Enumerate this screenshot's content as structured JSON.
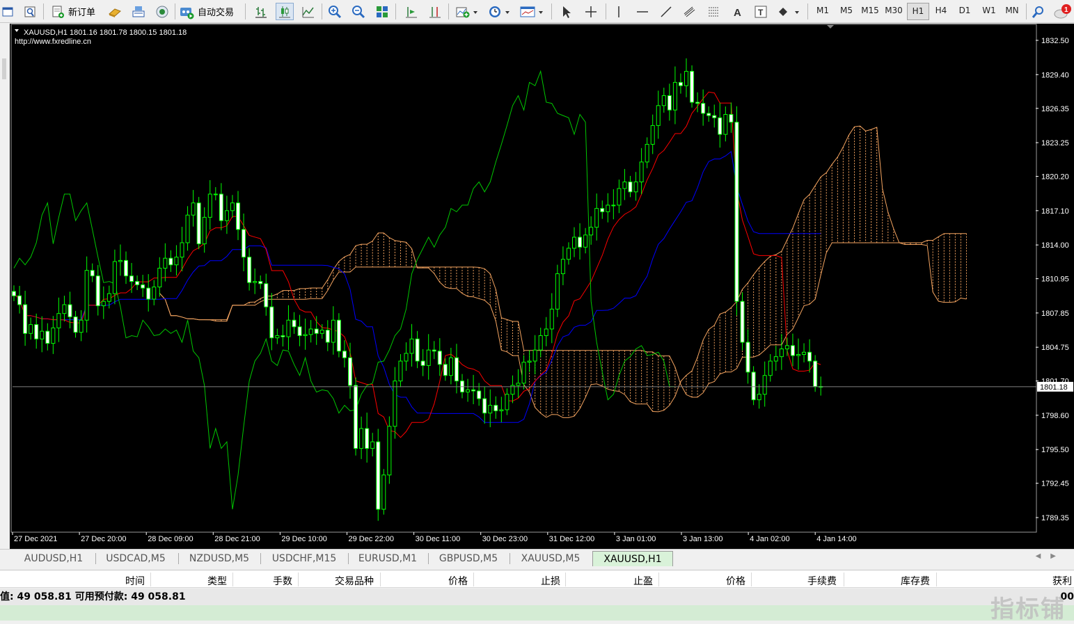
{
  "toolbar": {
    "new_order_label": "新订单",
    "auto_trading_label": "自动交易",
    "timeframes": [
      "M1",
      "M5",
      "M15",
      "M30",
      "H1",
      "H4",
      "D1",
      "W1",
      "MN"
    ],
    "active_timeframe": "H1",
    "notification_count": "1"
  },
  "chart": {
    "header": "XAUUSD,H1  1801.16 1801.78 1800.15 1801.18",
    "url": "http://www.fxredline.cn",
    "current_price_label": "1801.18"
  },
  "chart_data": {
    "type": "candlestick",
    "symbol": "XAUUSD",
    "timeframe": "H1",
    "ohlc_last": {
      "open": 1801.16,
      "high": 1801.78,
      "low": 1800.15,
      "close": 1801.18
    },
    "ylim": [
      1788.0,
      1834.0
    ],
    "y_ticks": [
      1832.5,
      1829.4,
      1826.35,
      1823.25,
      1820.2,
      1817.1,
      1814.0,
      1810.95,
      1807.85,
      1804.75,
      1801.7,
      1798.6,
      1795.5,
      1792.45,
      1789.35
    ],
    "y_tick_labels": [
      "1832.50",
      "1829.40",
      "1826.35",
      "1823.25",
      "1820.20",
      "1817.10",
      "1814.00",
      "1810.95",
      "1807.85",
      "1804.75",
      "1801.70",
      "1798.60",
      "1795.50",
      "1792.45",
      "1789.35"
    ],
    "x_tick_labels": [
      "27 Dec 2021",
      "27 Dec 20:00",
      "28 Dec 09:00",
      "28 Dec 21:00",
      "29 Dec 10:00",
      "29 Dec 22:00",
      "30 Dec 11:00",
      "30 Dec 23:00",
      "31 Dec 12:00",
      "3 Jan 01:00",
      "3 Jan 13:00",
      "4 Jan 02:00",
      "4 Jan 14:00"
    ],
    "bar_count": 145,
    "candles_close": [
      1809.4,
      1808.6,
      1806.0,
      1806.8,
      1805.5,
      1806.2,
      1805.1,
      1806.5,
      1807.8,
      1808.6,
      1807.5,
      1806.1,
      1807.2,
      1811.7,
      1811.2,
      1808.5,
      1808.9,
      1809.6,
      1812.5,
      1812.6,
      1811.2,
      1810.7,
      1810.4,
      1810.1,
      1809.1,
      1810.2,
      1811.9,
      1812.8,
      1812.2,
      1812.9,
      1814.2,
      1816.7,
      1817.8,
      1814.1,
      1816.5,
      1818.6,
      1818.6,
      1816.2,
      1817.1,
      1817.8,
      1815.4,
      1812.9,
      1810.6,
      1810.7,
      1810.5,
      1808.4,
      1805.6,
      1805.8,
      1805.7,
      1807.2,
      1806.6,
      1805.8,
      1805.9,
      1806.4,
      1806.0,
      1806.3,
      1805.2,
      1807.2,
      1804.4,
      1803.8,
      1801.3,
      1795.6,
      1797.4,
      1795.6,
      1796.2,
      1790.1,
      1793.2,
      1797.6,
      1801.7,
      1803.5,
      1804.2,
      1805.5,
      1803.5,
      1803.1,
      1804.5,
      1804.4,
      1803.2,
      1802.2,
      1803.8,
      1801.7,
      1800.7,
      1800.9,
      1800.8,
      1800.1,
      1798.8,
      1799.5,
      1799.0,
      1799.1,
      1800.5,
      1801.3,
      1801.5,
      1803.4,
      1803.5,
      1804.5,
      1805.8,
      1806.4,
      1808.2,
      1811.4,
      1812.7,
      1813.7,
      1814.7,
      1813.8,
      1814.9,
      1815.6,
      1817.3,
      1817.0,
      1817.6,
      1817.6,
      1819.1,
      1819.7,
      1818.8,
      1819.7,
      1821.5,
      1823.1,
      1824.8,
      1826.6,
      1827.5,
      1826.2,
      1828.7,
      1828.4,
      1829.7,
      1826.9,
      1826.8,
      1825.9,
      1825.7,
      1825.5,
      1824.0,
      1825.8,
      1825.1,
      1808.9,
      1805.2,
      1802.5,
      1800.0,
      1800.5,
      1802.2,
      1803.5,
      1803.9,
      1804.6,
      1804.9,
      1804.0,
      1804.1,
      1804.3,
      1803.5,
      1801.2,
      1801.18
    ]
  },
  "tabs": [
    "AUDUSD,H1",
    "USDCAD,M5",
    "NZDUSD,M5",
    "USDCHF,M15",
    "EURUSD,M1",
    "GBPUSD,M5",
    "XAUUSD,M5",
    "XAUUSD,H1"
  ],
  "active_tab": "XAUUSD,H1",
  "terminal": {
    "headers": [
      "时间",
      "类型",
      "手数",
      "交易品种",
      "价格",
      "止损",
      "止盈",
      "价格",
      "手续费",
      "库存费",
      "获利"
    ],
    "balance_line": "值: 49 058.81  可用预付款: 49 058.81",
    "balance_tail": "00"
  },
  "watermark": "指标铺",
  "colors": {
    "background": "#000000",
    "candle_bull": "#ffffff",
    "candle_bear": "#ffffff",
    "candle_wick": "#00ff00",
    "tenkan": "#ff0000",
    "kijun": "#0000ff",
    "chikou": "#00c800",
    "kumo": "#f4a460",
    "grid_text": "#ffffff"
  }
}
